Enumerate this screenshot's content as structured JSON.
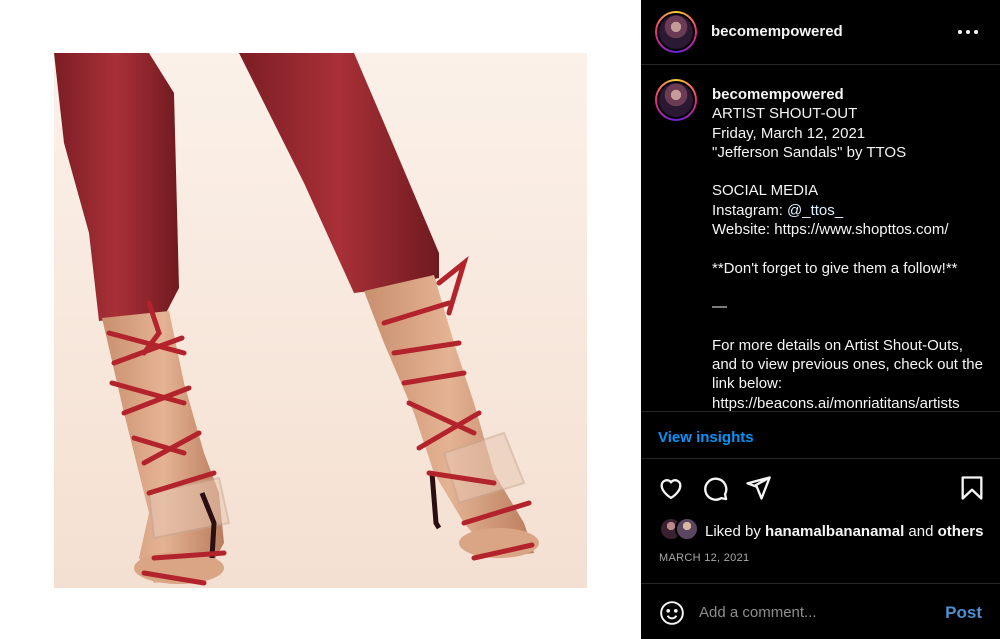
{
  "post": {
    "image_alt": "Legs in red leather pants wearing red snakeskin lace-up clear heeled sandals"
  },
  "header": {
    "username": "becomempowered",
    "more_icon": "more-horizontal-icon"
  },
  "caption": {
    "username": "becomempowered",
    "line1": "ARTIST SHOUT-OUT",
    "line2": "Friday, March 12, 2021",
    "line3": "\"Jefferson Sandals\" by TTOS",
    "line4": "SOCIAL MEDIA",
    "instagram_label": "Instagram: ",
    "instagram_handle": "@_ttos_",
    "website": "Website: https://www.shopttos.com/",
    "follow": "**Don't forget to give them a follow!**",
    "divider": "—",
    "more1": "For more details on Artist Shout-Outs, and to view previous ones, check out the link below:",
    "link": "https://beacons.ai/monriatitans/artists"
  },
  "insights": {
    "label": "View insights"
  },
  "actions": {
    "like_icon": "heart-icon",
    "comment_icon": "comment-icon",
    "share_icon": "paper-plane-icon",
    "save_icon": "bookmark-icon"
  },
  "likes": {
    "prefix": "Liked by ",
    "user": "hanamalbananamal",
    "joiner": " and ",
    "others": "others"
  },
  "date": "MARCH 12, 2021",
  "comment": {
    "placeholder": "Add a comment...",
    "post_label": "Post",
    "emoji_icon": "emoji-icon"
  }
}
